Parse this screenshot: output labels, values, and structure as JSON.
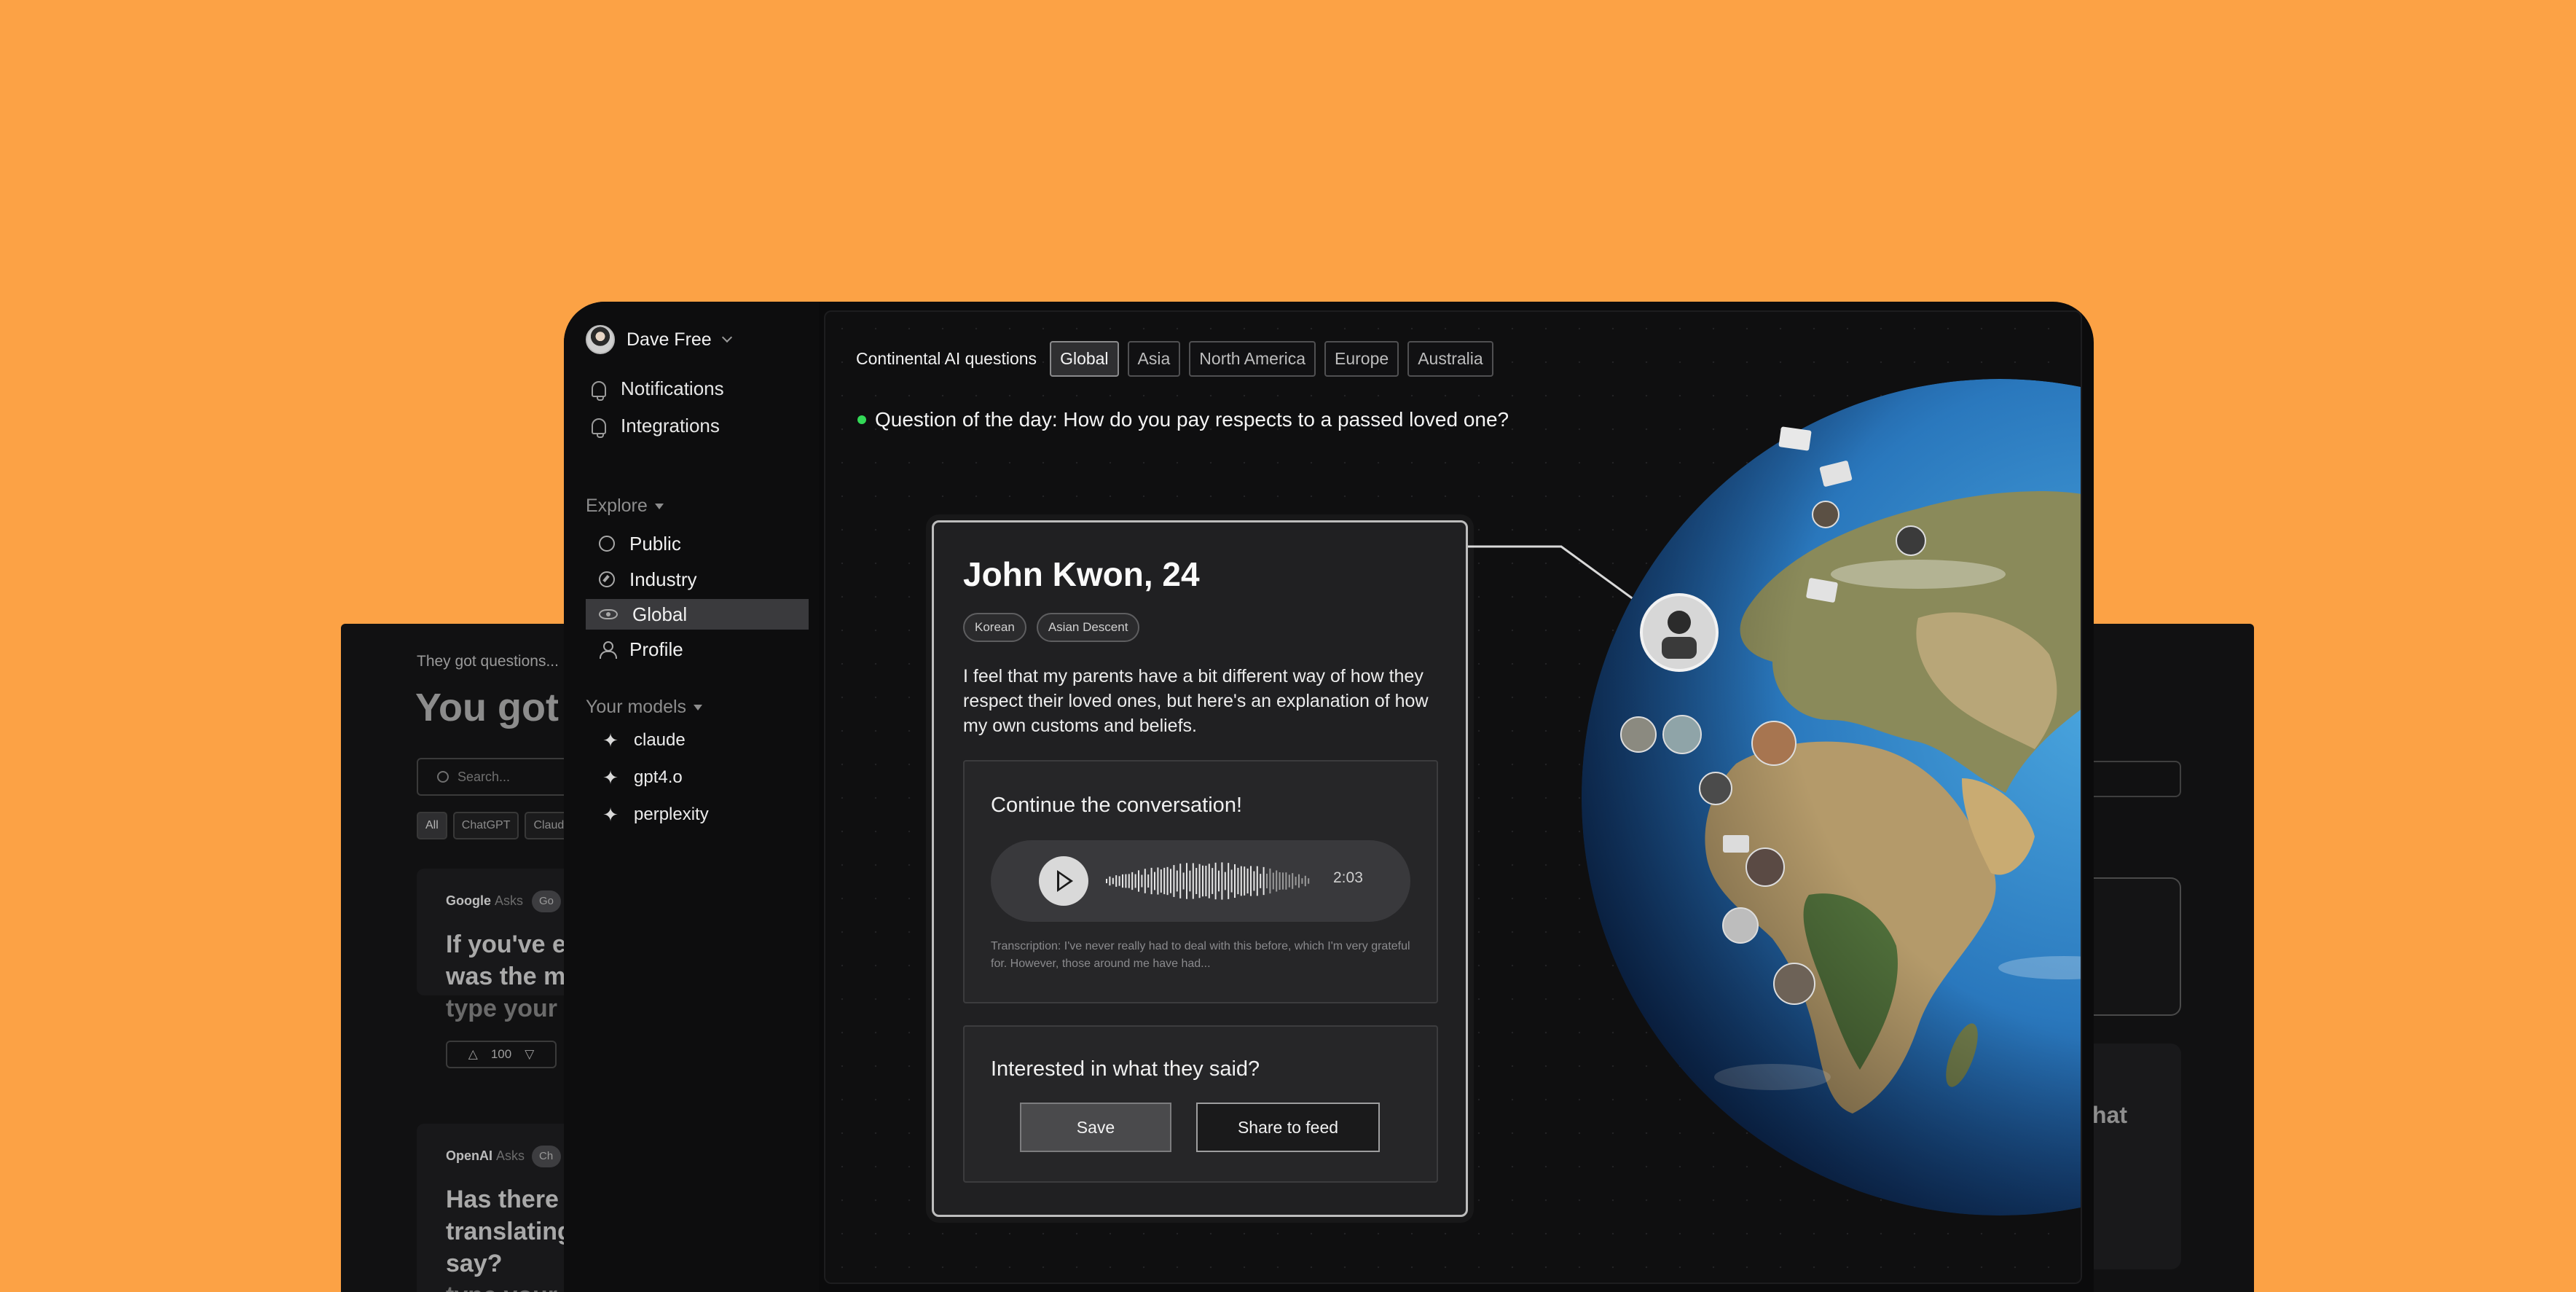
{
  "back_window": {
    "subtitle": "They got questions...",
    "title": "You got",
    "search_placeholder": "Search...",
    "filters": [
      "All",
      "ChatGPT",
      "Claud"
    ],
    "cards": [
      {
        "asker": "Google",
        "asks": "Asks",
        "badge": "Go",
        "question": "If you've ev\nwas the mo",
        "hint": "type your a",
        "votes": "100"
      },
      {
        "asker": "OpenAI",
        "asks": "Asks",
        "badge": "Ch",
        "question": "Has there b\ntranslating\nsay?",
        "hint": "type your a"
      }
    ],
    "right_fragment": "hat"
  },
  "sidebar": {
    "user": "Dave Free",
    "top_items": [
      {
        "label": "Notifications",
        "icon": "bell-icon"
      },
      {
        "label": "Integrations",
        "icon": "bell-icon"
      }
    ],
    "explore_label": "Explore",
    "explore_items": [
      {
        "label": "Public",
        "icon": "circle-icon"
      },
      {
        "label": "Industry",
        "icon": "compass-icon"
      },
      {
        "label": "Global",
        "icon": "eye-icon",
        "active": true
      },
      {
        "label": "Profile",
        "icon": "person-icon"
      }
    ],
    "models_label": "Your models",
    "models": [
      "claude",
      "gpt4.o",
      "perplexity"
    ]
  },
  "content": {
    "tabs_label": "Continental AI questions",
    "tabs": [
      "Global",
      "Asia",
      "North America",
      "Europe",
      "Australia"
    ],
    "active_tab": "Global",
    "question_of_day": "Question of the day: How do you pay respects to a passed loved one?"
  },
  "profile_card": {
    "name": "John Kwon, 24",
    "tags": [
      "Korean",
      "Asian Descent"
    ],
    "bio": "I feel that my parents have a bit different way of how they respect their loved ones, but here's an explanation of how my own customs and beliefs.",
    "continue_heading": "Continue the conversation!",
    "audio_duration": "2:03",
    "transcription": "Transcription: I've never really had to deal with this before, which I'm very grateful for. However, those around me have had...",
    "interest_heading": "Interested in what they said?",
    "save_label": "Save",
    "share_label": "Share to feed"
  },
  "colors": {
    "background": "#FCA245",
    "live_dot": "#33d957",
    "window": "#0b0b0c"
  }
}
